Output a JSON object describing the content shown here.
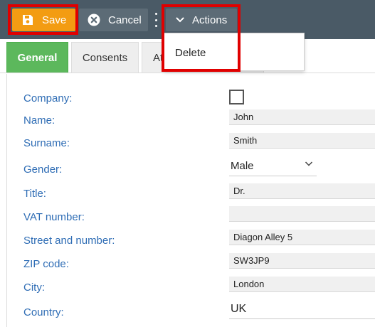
{
  "toolbar": {
    "save_label": "Save",
    "cancel_label": "Cancel",
    "actions_label": "Actions",
    "save_color": "#f39c12",
    "bar_color": "#4a5a66",
    "button_color": "#5c6b76"
  },
  "dropdown": {
    "items": [
      {
        "label": "Delete"
      }
    ]
  },
  "tabs": [
    {
      "label": "General",
      "active": true
    },
    {
      "label": "Consents",
      "active": false
    },
    {
      "label": "At",
      "active": false
    }
  ],
  "form": {
    "company": {
      "label": "Company:",
      "checked": false
    },
    "name": {
      "label": "Name:",
      "value": "John"
    },
    "surname": {
      "label": "Surname:",
      "value": "Smith"
    },
    "gender": {
      "label": "Gender:",
      "value": "Male"
    },
    "title": {
      "label": "Title:",
      "value": "Dr."
    },
    "vat": {
      "label": "VAT number:",
      "value": ""
    },
    "street": {
      "label": "Street and number:",
      "value": "Diagon Alley 5"
    },
    "zip": {
      "label": "ZIP code:",
      "value": "SW3JP9"
    },
    "city": {
      "label": "City:",
      "value": "London"
    },
    "country": {
      "label": "Country:",
      "value": "UK"
    }
  },
  "colors": {
    "highlight": "#e00000",
    "label": "#2f6db5",
    "tab_active": "#5cb85c"
  }
}
